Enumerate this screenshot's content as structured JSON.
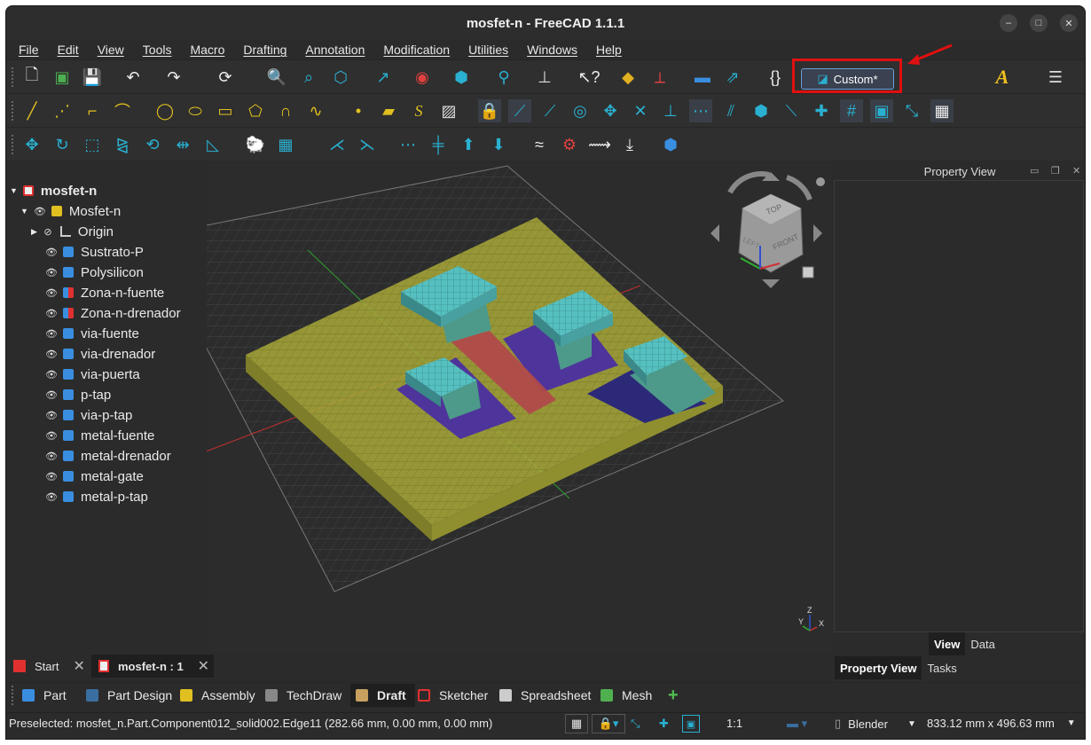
{
  "window": {
    "title": "mosfet-n - FreeCAD 1.1.1"
  },
  "menu": [
    "File",
    "Edit",
    "View",
    "Tools",
    "Macro",
    "Drafting",
    "Annotation",
    "Modification",
    "Utilities",
    "Windows",
    "Help"
  ],
  "toolbar": {
    "custom_label": "Custom*",
    "braces_label": "{}"
  },
  "tree": {
    "root": "mosfet-n",
    "part": "Mosfet-n",
    "items": [
      "Origin",
      "Sustrato-P",
      "Polysilicon",
      "Zona-n-fuente",
      "Zona-n-drenador",
      "via-fuente",
      "via-drenador",
      "via-puerta",
      "p-tap",
      "via-p-tap",
      "metal-fuente",
      "metal-drenador",
      "metal-gate",
      "metal-p-tap"
    ]
  },
  "navcube": {
    "top": "TOP",
    "front": "FRONT",
    "left": "LEFT"
  },
  "axis": {
    "z": "Z",
    "y": "Y",
    "x": "X"
  },
  "right_panel": {
    "title": "Property View",
    "tab_view": "View",
    "tab_data": "Data",
    "tab_property_view": "Property View",
    "tab_tasks": "Tasks"
  },
  "doc_tabs": [
    "Start",
    "mosfet-n : 1"
  ],
  "workbenches": [
    "Part",
    "Part Design",
    "Assembly",
    "TechDraw",
    "Draft",
    "Sketcher",
    "Spreadsheet",
    "Mesh"
  ],
  "status": {
    "preselected": "Preselected: mosfet_n.Part.Component012_solid002.Edge11 (282.66 mm, 0.00 mm, 0.00 mm)",
    "scale": "1:1",
    "nav_style": "Blender",
    "dimensions": "833.12 mm x 496.63 mm"
  },
  "colors": {
    "accent": "#6a9fd8",
    "highlight": "#e01010",
    "substrate": "#a9a93a",
    "metal": "#56c0c0",
    "poly": "#b04a4a",
    "diffusion": "#4a2fa0"
  }
}
